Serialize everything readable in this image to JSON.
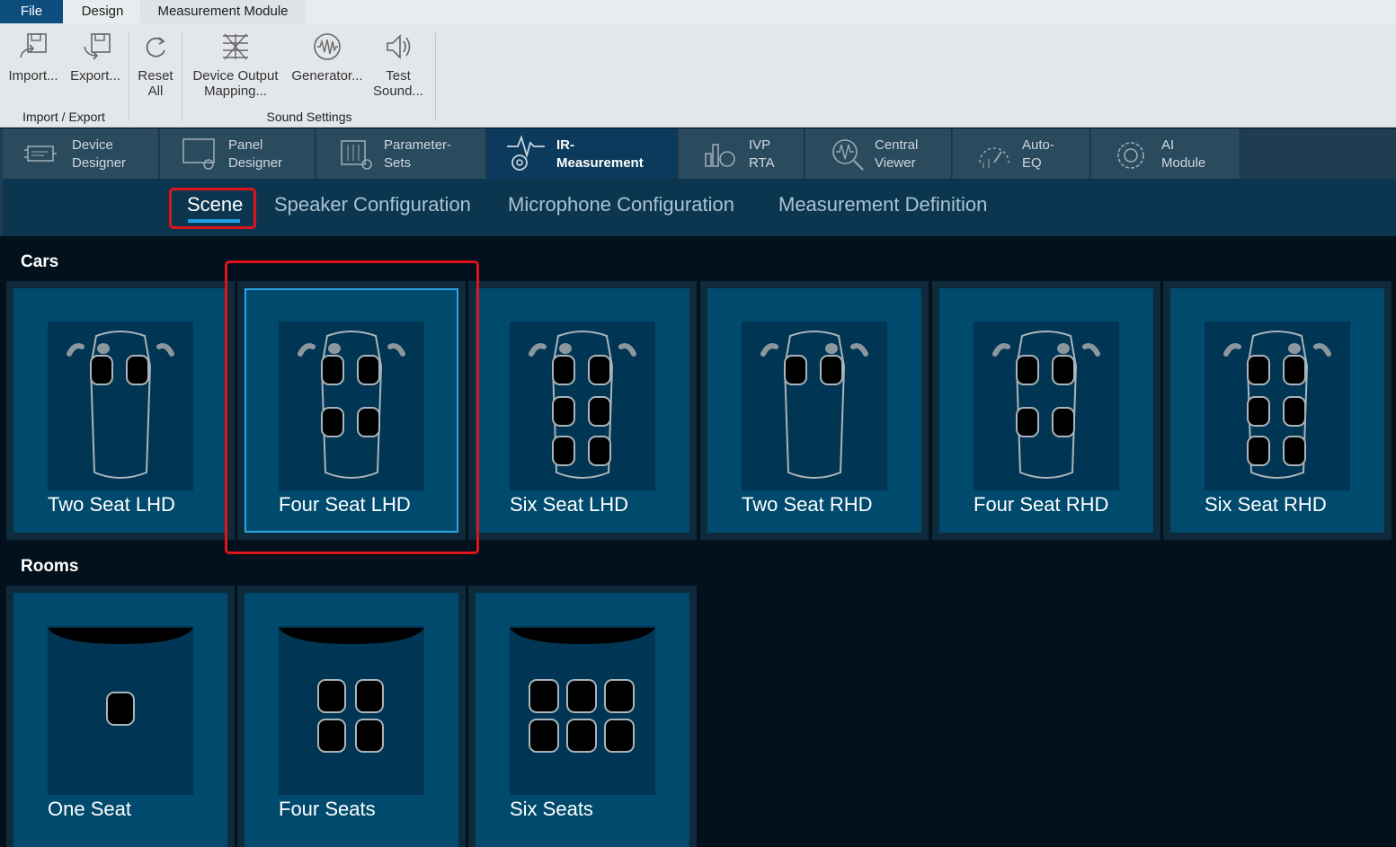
{
  "menu": {
    "file": "File",
    "design": "Design",
    "measurement_module": "Measurement Module"
  },
  "ribbon": {
    "import": "Import...",
    "export": "Export...",
    "reset_l1": "Reset",
    "reset_l2": "All",
    "dom_l1": "Device Output",
    "dom_l2": "Mapping...",
    "generator": "Generator...",
    "test_l1": "Test",
    "test_l2": "Sound...",
    "group_import_export": "Import / Export",
    "group_sound_settings": "Sound Settings"
  },
  "modules": [
    {
      "l1": "Device",
      "l2": "Designer",
      "icon": "device-designer-icon"
    },
    {
      "l1": "Panel",
      "l2": "Designer",
      "icon": "panel-designer-icon"
    },
    {
      "l1": "Parameter-",
      "l2": "Sets",
      "icon": "parameter-sets-icon"
    },
    {
      "l1": "IR-",
      "l2": "Measurement",
      "icon": "ir-measurement-icon",
      "active": true
    },
    {
      "l1": "IVP",
      "l2": "RTA",
      "icon": "ivp-rta-icon"
    },
    {
      "l1": "Central",
      "l2": "Viewer",
      "icon": "central-viewer-icon"
    },
    {
      "l1": "Auto-",
      "l2": "EQ",
      "icon": "auto-eq-icon"
    },
    {
      "l1": "AI",
      "l2": "Module",
      "icon": "ai-module-icon"
    }
  ],
  "subnav": {
    "scene": "Scene",
    "speaker": "Speaker Configuration",
    "microphone": "Microphone Configuration",
    "measurement": "Measurement Definition",
    "active": "Scene"
  },
  "sections": {
    "cars": "Cars",
    "rooms": "Rooms"
  },
  "cars": [
    {
      "name": "Two Seat LHD",
      "rows": 1,
      "wheel": "left"
    },
    {
      "name": "Four Seat LHD",
      "rows": 2,
      "wheel": "left",
      "selected": true
    },
    {
      "name": "Six Seat LHD",
      "rows": 3,
      "wheel": "left"
    },
    {
      "name": "Two Seat RHD",
      "rows": 1,
      "wheel": "right"
    },
    {
      "name": "Four Seat RHD",
      "rows": 2,
      "wheel": "right"
    },
    {
      "name": "Six Seat RHD",
      "rows": 3,
      "wheel": "right"
    }
  ],
  "rooms": [
    {
      "name": "One Seat",
      "seats": 1
    },
    {
      "name": "Four Seats",
      "seats": 4
    },
    {
      "name": "Six Seats",
      "seats": 6
    }
  ],
  "colors": {
    "accent": "#1aa0e8",
    "highlight_red": "#e0131b",
    "tile_bg": "#004a6e",
    "active_module": "#0b3a5c"
  }
}
